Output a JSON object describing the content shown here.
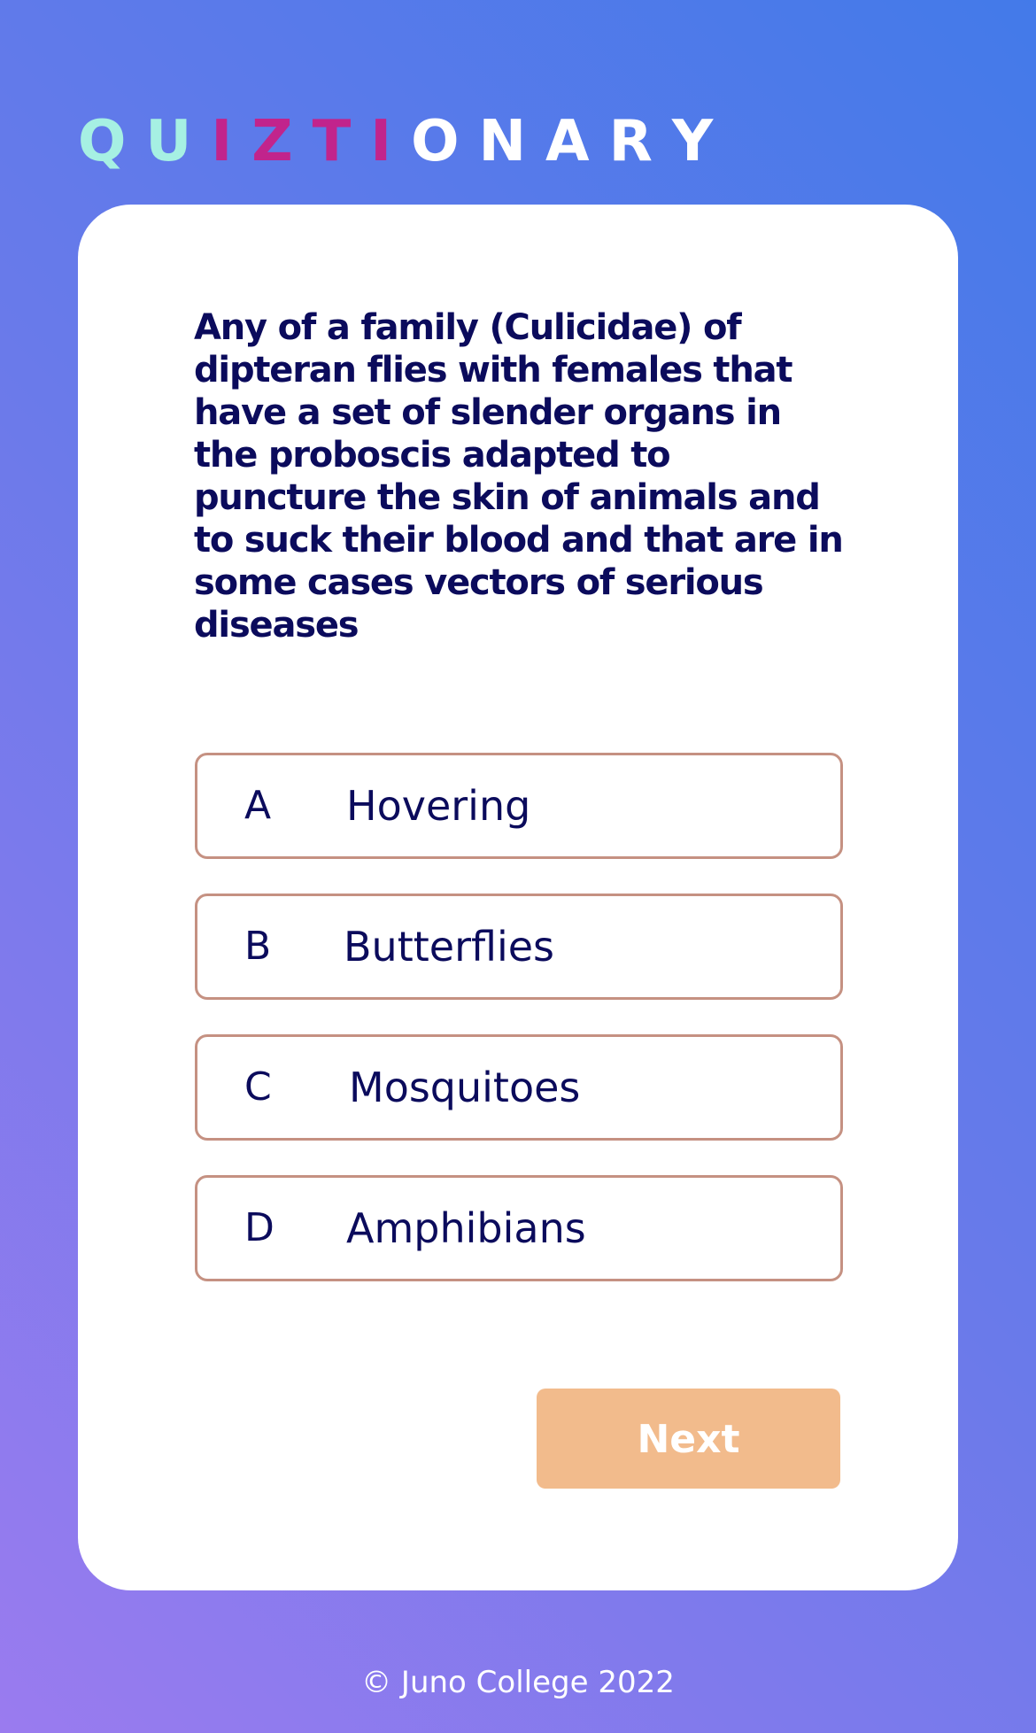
{
  "logo": {
    "letters": [
      "Q",
      "U",
      "I",
      "Z",
      "T",
      "I",
      "O",
      "N",
      "A",
      "R",
      "Y"
    ],
    "colors": [
      "#a6f0e3",
      "#a6f0e3",
      "#c1248c",
      "#c1248c",
      "#c1248c",
      "#c1248c",
      "#ffffff",
      "#ffffff",
      "#ffffff",
      "#ffffff",
      "#ffffff"
    ]
  },
  "question": {
    "text": "Any of a family (Culicidae) of dipteran flies with females that have a set of slender organs in the proboscis adapted to puncture the skin of animals and to suck their blood and that are in some cases vectors of serious diseases"
  },
  "options": [
    {
      "letter": "A",
      "text": "Hovering"
    },
    {
      "letter": "B",
      "text": "Butterflies"
    },
    {
      "letter": "C",
      "text": "Mosquitoes"
    },
    {
      "letter": "D",
      "text": "Amphibians"
    }
  ],
  "next_button": {
    "label": "Next",
    "color": "#f2bb8c"
  },
  "footer": {
    "text": "© Juno College 2022"
  },
  "colors": {
    "text_dark": "#0b0b5c",
    "option_border": "#c59182",
    "card_background": "#ffffff",
    "gradient_top_right": "#437ae9",
    "gradient_bottom_left": "#9a7bef"
  }
}
